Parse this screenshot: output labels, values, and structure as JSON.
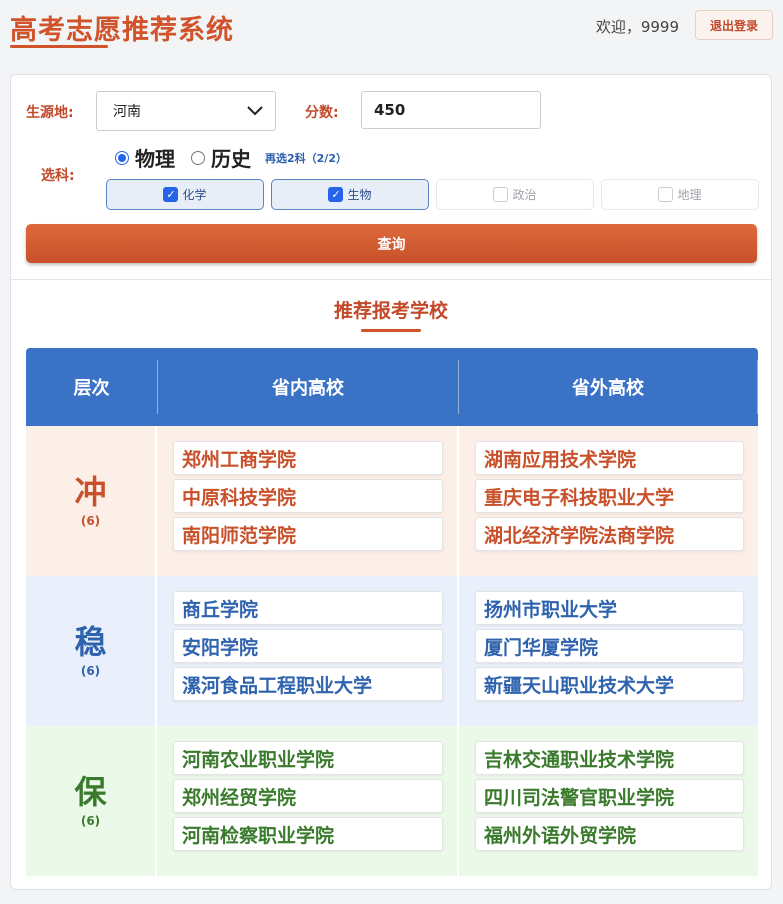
{
  "header": {
    "title": "高考志愿推荐系统",
    "welcome": "欢迎，9999",
    "logout_label": "退出登录"
  },
  "form": {
    "province_label": "生源地:",
    "province_value": "河南",
    "score_label": "分数:",
    "score_value": "450",
    "subject_label": "选科:",
    "primary_options": [
      {
        "label": "物理",
        "checked": true
      },
      {
        "label": "历史",
        "checked": false
      }
    ],
    "hint": "再选2科（2/2）",
    "secondary_options": [
      {
        "label": "化学",
        "checked": true
      },
      {
        "label": "生物",
        "checked": true
      },
      {
        "label": "政治",
        "checked": false
      },
      {
        "label": "地理",
        "checked": false
      }
    ],
    "query_label": "查询"
  },
  "results": {
    "title": "推荐报考学校",
    "headers": [
      "层次",
      "省内高校",
      "省外高校"
    ],
    "tiers": [
      {
        "name": "冲",
        "count": "(6)",
        "in_province": [
          "郑州工商学院",
          "中原科技学院",
          "南阳师范学院"
        ],
        "out_province": [
          "湖南应用技术学院",
          "重庆电子科技职业大学",
          "湖北经济学院法商学院"
        ]
      },
      {
        "name": "稳",
        "count": "(6)",
        "in_province": [
          "商丘学院",
          "安阳学院",
          "漯河食品工程职业大学"
        ],
        "out_province": [
          "扬州市职业大学",
          "厦门华厦学院",
          "新疆天山职业技术大学"
        ]
      },
      {
        "name": "保",
        "count": "(6)",
        "in_province": [
          "河南农业职业学院",
          "郑州经贸学院",
          "河南检察职业学院"
        ],
        "out_province": [
          "吉林交通职业技术学院",
          "四川司法警官职业学院",
          "福州外语外贸学院"
        ]
      }
    ]
  },
  "colors": {
    "brand": "#d0532a",
    "header_blue": "#3a72c6",
    "chong": "#c8502a",
    "wen": "#2f63ad",
    "bao": "#3a7a2c"
  },
  "icons": {
    "select_arrow": "chevron-down-icon",
    "checkbox": "checkbox-icon"
  }
}
